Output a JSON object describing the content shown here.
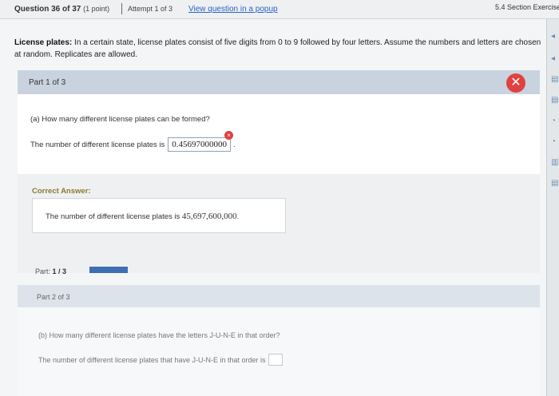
{
  "topbar": {
    "question": "Question 36 of 37",
    "point": "(1 point)",
    "attempt": "Attempt 1 of 3",
    "popup_link": "View question in a popup",
    "section": "5.4 Section Exercise"
  },
  "problem": {
    "label": "License plates:",
    "text": "In a certain state, license plates consist of five digits from 0 to 9 followed by four letters. Assume the numbers and letters are chosen at random. Replicates are allowed."
  },
  "part1": {
    "header": "Part 1 of 3",
    "question": "(a) How many different license plates can be formed?",
    "answer_prefix": "The number of different license plates is",
    "answer_value": "0.45697000000",
    "answer_suffix": "."
  },
  "correct": {
    "title": "Correct Answer:",
    "prefix": "The number of different license plates is",
    "value": "45,697,600,000",
    "suffix": "."
  },
  "progress": {
    "label": "Part:",
    "value": "1 / 3",
    "fraction": 0.33
  },
  "part2": {
    "header": "Part 2 of 3",
    "question": "(b) How many different license plates have the letters J-U-N-E in that order?",
    "answer_prefix": "The number of different license plates that have J-U-N-E in that order is",
    "answer_value": ""
  },
  "colors": {
    "error_red": "#e04140",
    "link_blue": "#2a64c5",
    "progress_blue": "#3d6fb4",
    "correct_title": "#8a7a30"
  },
  "icons": {
    "close": "x-icon",
    "error": "error-icon"
  }
}
